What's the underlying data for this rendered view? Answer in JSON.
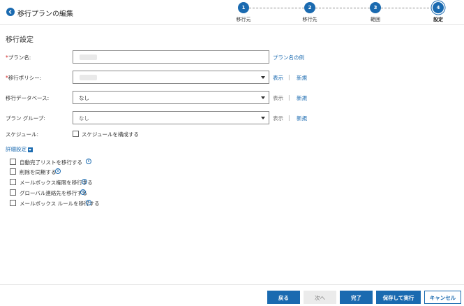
{
  "header": {
    "title": "移行プランの編集",
    "steps": [
      {
        "number": "1",
        "label": "移行元"
      },
      {
        "number": "2",
        "label": "移行先"
      },
      {
        "number": "3",
        "label": "範囲"
      },
      {
        "number": "4",
        "label": "設定",
        "active": true
      }
    ]
  },
  "section": {
    "title": "移行設定"
  },
  "form": {
    "plan_name": {
      "label": "プラン名:",
      "required_mark": "*",
      "example_link": "プラン名の例"
    },
    "policy": {
      "label": "移行ポリシー:",
      "required_mark": "*",
      "view_link": "表示",
      "new_link": "新規",
      "separator": "|"
    },
    "database": {
      "label": "移行データベース:",
      "value": "なし",
      "view_link": "表示",
      "new_link": "新規",
      "separator": "|"
    },
    "plan_group": {
      "label": "プラン グループ:",
      "value": "なし",
      "view_link": "表示",
      "new_link": "新規",
      "separator": "|"
    },
    "schedule": {
      "label": "スケジュール:",
      "checkbox_label": "スケジュールを構成する"
    }
  },
  "advanced": {
    "toggle_label": "詳細設定",
    "options": [
      {
        "label": "自動完了リストを移行する",
        "checked": false
      },
      {
        "label": "削除を同期する",
        "checked": false
      },
      {
        "label": "メールボックス権限を移行する",
        "checked": false
      },
      {
        "label": "グローバル連絡先を移行する",
        "checked": false
      },
      {
        "label": "メールボックス ルールを移行する",
        "checked": false
      }
    ],
    "info_glyph": "i"
  },
  "footer": {
    "back_label": "戻る",
    "next_label": "次へ",
    "finish_label": "完了",
    "save_run_label": "保存して実行",
    "cancel_label": "キャンセル"
  },
  "icons": {
    "back": "arrow-left-circle-icon",
    "dropdown": "chevron-down-icon",
    "info": "info-icon"
  },
  "colors": {
    "accent": "#1a6ab0",
    "required": "#d22020",
    "disabled_button": "#ebebeb"
  }
}
